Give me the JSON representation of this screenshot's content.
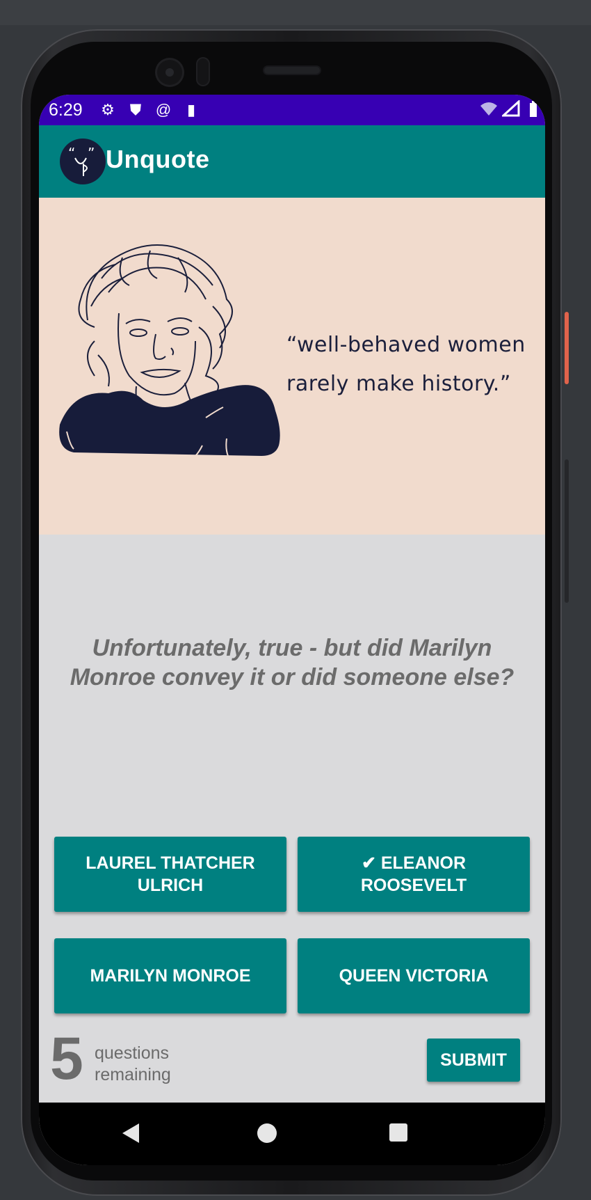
{
  "status_bar": {
    "time": "6:29",
    "left_icons": [
      "gear-icon",
      "shield-icon",
      "at-icon",
      "sd-card-icon"
    ],
    "right_icons": [
      "wifi-icon",
      "signal-icon",
      "battery-icon"
    ]
  },
  "app_bar": {
    "title": "Unquote",
    "logo_text": "“ ”",
    "logo_face": "U P"
  },
  "quote": {
    "text_line1": "“well-behaved women",
    "text_line2": "rarely make history.”"
  },
  "question": {
    "text": "Unfortunately, true - but did Marilyn Monroe convey it or did someone else?"
  },
  "answers": [
    {
      "label": "LAUREL THATCHER ULRICH",
      "selected": false
    },
    {
      "label": "✔ ELEANOR ROOSEVELT",
      "selected": true
    },
    {
      "label": "MARILYN MONROE",
      "selected": false
    },
    {
      "label": "QUEEN VICTORIA",
      "selected": false
    }
  ],
  "footer": {
    "remaining_count": "5",
    "remaining_label": "questions remaining",
    "submit_label": "SUBMIT"
  },
  "colors": {
    "accent": "#008080",
    "status_bar": "#3700b3",
    "quote_bg": "#f1dbcd",
    "body_bg": "#dadadc",
    "ink": "#1b1f3b",
    "muted_text": "#6b6b6b"
  }
}
